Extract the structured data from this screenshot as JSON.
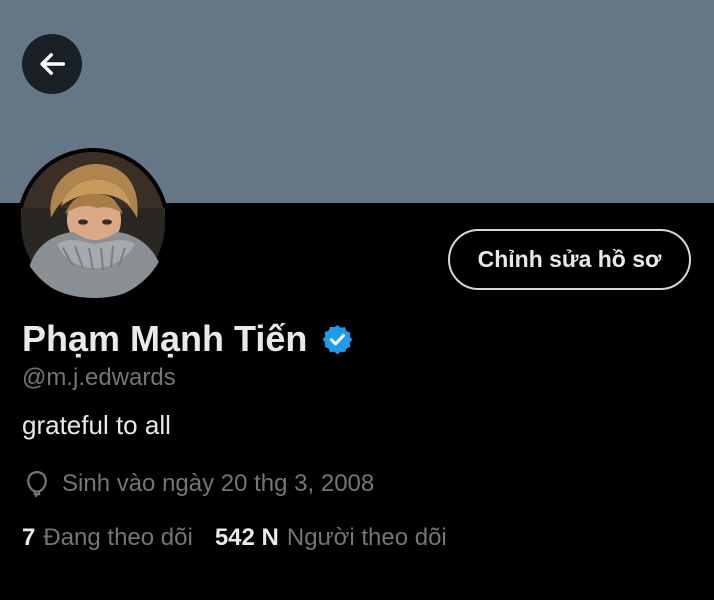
{
  "colors": {
    "background": "#000000",
    "banner": "#657786",
    "text_primary": "#e7e9ea",
    "text_secondary": "#71767b",
    "verified_badge": "#1d9bf0",
    "button_border": "#cfd9de"
  },
  "header": {
    "back_icon": "arrow-left-icon"
  },
  "profile": {
    "avatar_icon": "profile-photo",
    "edit_button_label": "Chỉnh sửa hồ sơ",
    "display_name": "Phạm Mạnh Tiến",
    "verified_icon": "verified-badge-icon",
    "handle": "@m.j.edwards",
    "bio": "grateful to all",
    "birthday_icon": "balloon-icon",
    "birthday": "Sinh vào ngày 20 thg 3, 2008"
  },
  "stats": {
    "following_count": "7",
    "following_label": "Đang theo dõi",
    "followers_count": "542 N",
    "followers_label": "Người theo dõi"
  }
}
